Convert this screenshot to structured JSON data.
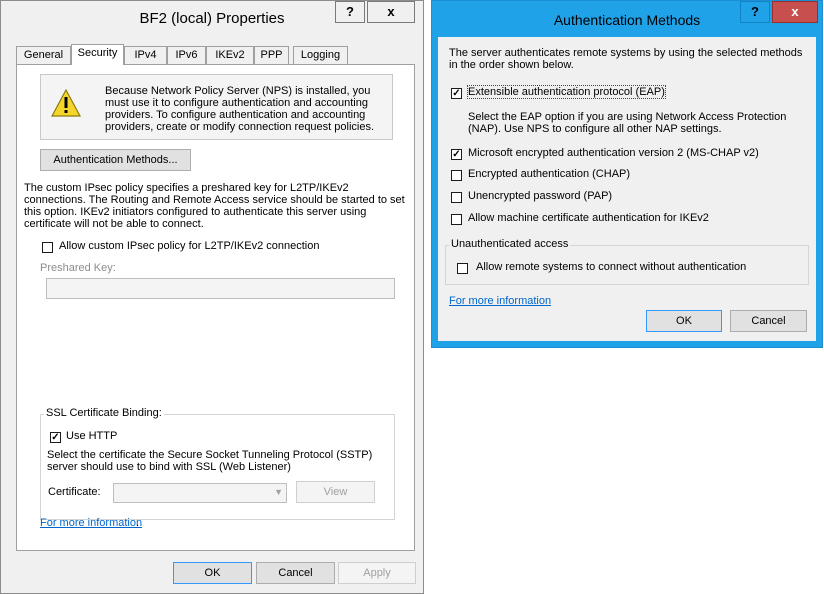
{
  "props_window": {
    "title": "BF2 (local) Properties",
    "help_glyph": "?",
    "close_glyph": "x",
    "tabs": [
      {
        "label": "General"
      },
      {
        "label": "Security"
      },
      {
        "label": "IPv4"
      },
      {
        "label": "IPv6"
      },
      {
        "label": "IKEv2"
      },
      {
        "label": "PPP"
      },
      {
        "label": "Logging"
      }
    ],
    "warning_text": "Because Network Policy Server (NPS) is installed, you must use it to configure authentication and accounting providers. To configure authentication and accounting providers, create or modify connection request policies.",
    "auth_methods_button": "Authentication Methods...",
    "ipsec_text": "The custom IPsec policy specifies a preshared key for L2TP/IKEv2 connections. The Routing and Remote Access service should be started to set this option. IKEv2 initiators configured to authenticate this server using certificate will not be able to connect.",
    "allow_ipsec_label": "Allow custom IPsec policy for L2TP/IKEv2 connection",
    "allow_ipsec_checked": false,
    "preshared_key_label": "Preshared Key:",
    "preshared_key_value": "",
    "ssl_group_title": "SSL Certificate Binding:",
    "use_http_label": "Use HTTP",
    "use_http_checked": true,
    "sstp_text": "Select the certificate the Secure Socket Tunneling Protocol (SSTP) server should use to bind with SSL (Web Listener)",
    "certificate_label": "Certificate:",
    "certificate_value": "",
    "view_button": "View",
    "more_info_link": "For more information",
    "more_info_period": ".",
    "ok_button": "OK",
    "cancel_button": "Cancel",
    "apply_button": "Apply"
  },
  "auth_window": {
    "title": "Authentication Methods",
    "help_glyph": "?",
    "close_glyph": "x",
    "intro_text": "The server authenticates remote systems by using the selected methods in the order shown below.",
    "methods": [
      {
        "label": "Extensible authentication protocol (EAP)",
        "checked": true
      },
      {
        "label": "Microsoft encrypted authentication version 2 (MS-CHAP v2)",
        "checked": true
      },
      {
        "label": "Encrypted authentication (CHAP)",
        "checked": false
      },
      {
        "label": "Unencrypted password (PAP)",
        "checked": false
      },
      {
        "label": "Allow machine certificate authentication for IKEv2",
        "checked": false
      }
    ],
    "eap_note": "Select the EAP option if you are using Network Access Protection (NAP). Use NPS to configure all other NAP settings.",
    "unauth_group_title": "Unauthenticated access",
    "unauth_label": "Allow remote systems to connect without authentication",
    "unauth_checked": false,
    "more_info_link": "For more information",
    "ok_button": "OK",
    "cancel_button": "Cancel"
  },
  "colors": {
    "accent_frame": "#1fa2e8",
    "close_red": "#c7504f",
    "link": "#0066cc"
  },
  "icons": {
    "warning": "warning-icon"
  }
}
